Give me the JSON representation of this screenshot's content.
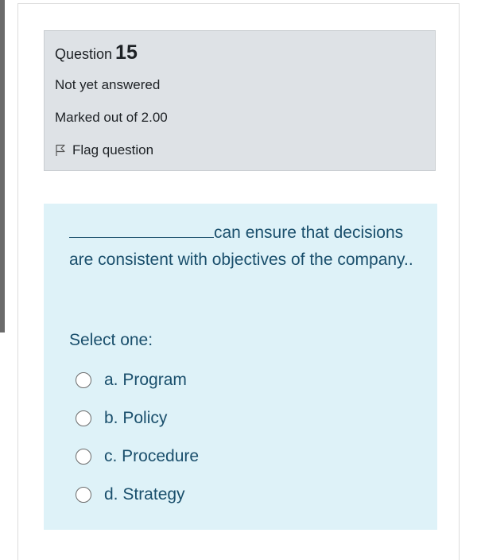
{
  "question": {
    "label": "Question",
    "number": "15",
    "state": "Not yet answered",
    "marks": "Marked out of 2.00",
    "flag_label": "Flag question"
  },
  "content": {
    "text_after_blank": "can ensure that decisions are consistent with objectives of the company..",
    "select_prompt": "Select one:",
    "options": [
      {
        "label": "a. Program"
      },
      {
        "label": "b. Policy"
      },
      {
        "label": "c. Procedure"
      },
      {
        "label": "d. Strategy"
      }
    ]
  },
  "colors": {
    "info_bg": "#dee2e6",
    "content_bg": "#def2f8",
    "content_text": "#1a4f6c"
  }
}
